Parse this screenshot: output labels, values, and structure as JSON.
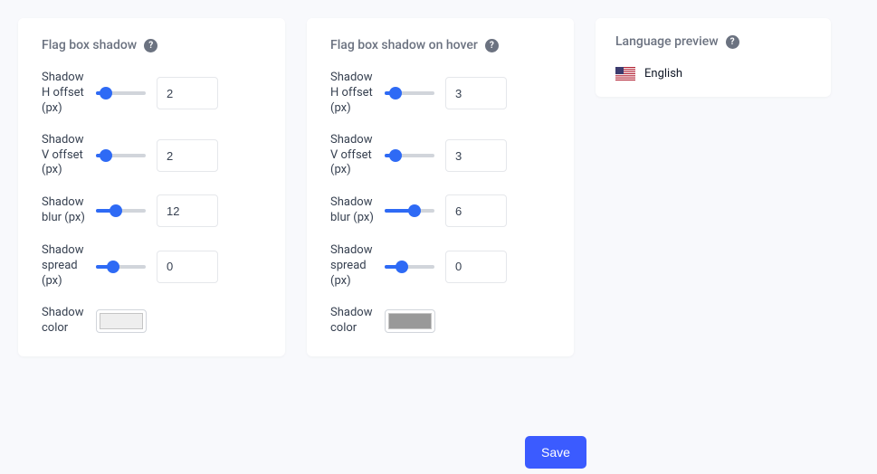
{
  "left": {
    "title": "Flag box shadow",
    "rows": [
      {
        "label": "Shadow H offset (px)",
        "value": "2",
        "pct": 20
      },
      {
        "label": "Shadow V offset (px)",
        "value": "2",
        "pct": 20
      },
      {
        "label": "Shadow blur (px)",
        "value": "12",
        "pct": 40
      },
      {
        "label": "Shadow spread (px)",
        "value": "0",
        "pct": 35
      }
    ],
    "colorLabel": "Shadow color",
    "color": "#eeeeee"
  },
  "right": {
    "title": "Flag box shadow on hover",
    "rows": [
      {
        "label": "Shadow H offset (px)",
        "value": "3",
        "pct": 22
      },
      {
        "label": "Shadow V offset (px)",
        "value": "3",
        "pct": 22
      },
      {
        "label": "Shadow blur (px)",
        "value": "6",
        "pct": 60
      },
      {
        "label": "Shadow spread (px)",
        "value": "0",
        "pct": 35
      }
    ],
    "colorLabel": "Shadow color",
    "color": "#999999"
  },
  "preview": {
    "title": "Language preview",
    "langName": "English"
  },
  "saveLabel": "Save"
}
